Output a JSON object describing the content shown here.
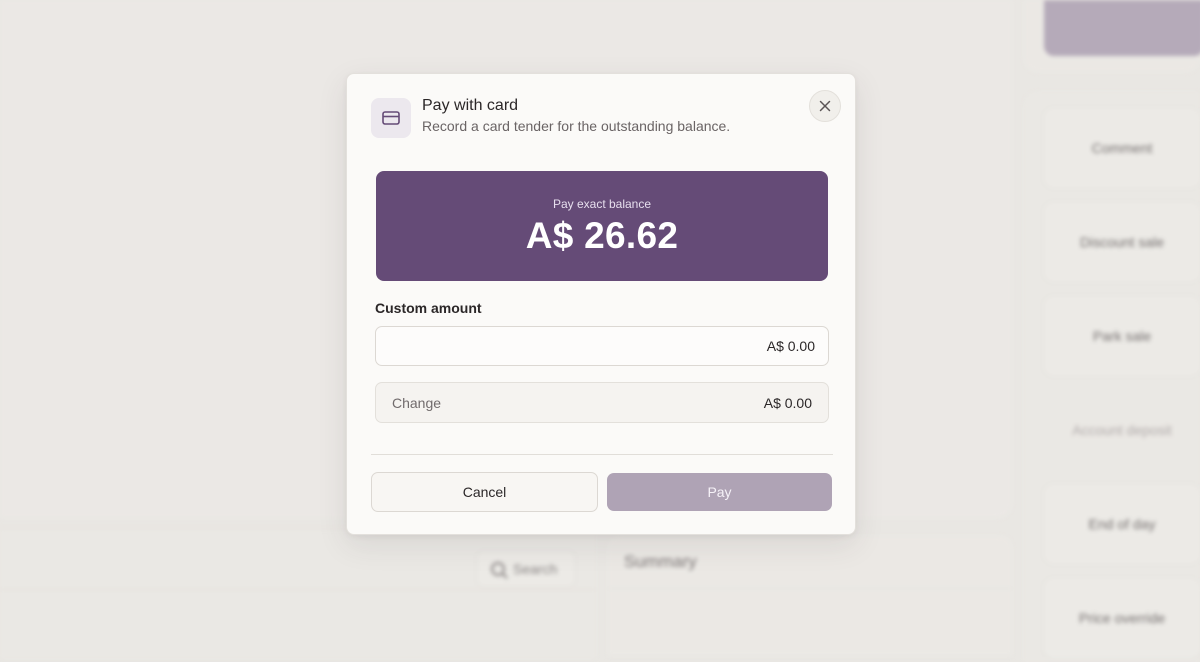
{
  "modal": {
    "title": "Pay with card",
    "subtitle": "Record a card tender for the outstanding balance.",
    "icon": "credit-card-icon",
    "close_icon": "close-icon",
    "exact_balance": {
      "label": "Pay exact balance",
      "amount": "A$ 26.62"
    },
    "custom_amount": {
      "label": "Custom amount",
      "value": "",
      "placeholder": "A$ 0.00"
    },
    "change": {
      "label": "Change",
      "value": "A$ 0.00"
    },
    "buttons": {
      "cancel": "Cancel",
      "pay": "Pay",
      "pay_disabled": true
    }
  },
  "background": {
    "search_label": "Search",
    "summary_title": "Summary",
    "actions": [
      "Comment",
      "Discount sale",
      "Park sale",
      "Account deposit",
      "End of day",
      "Price override"
    ]
  },
  "colors": {
    "accent": "#654b77",
    "pay_disabled": "#afa3b5",
    "modal_bg": "#fbfaf8",
    "page_bg": "#e9e7e3"
  }
}
